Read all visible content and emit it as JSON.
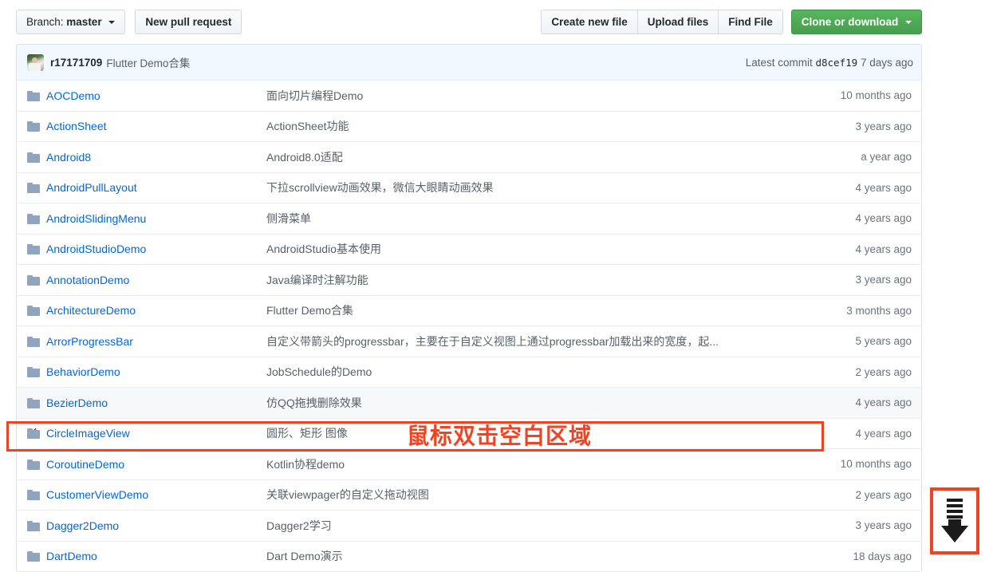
{
  "toolbar": {
    "branch_prefix": "Branch:",
    "branch_name": "master",
    "new_pull_request": "New pull request",
    "create_new_file": "Create new file",
    "upload_files": "Upload files",
    "find_file": "Find File",
    "clone_or_download": "Clone or download"
  },
  "commit_bar": {
    "author": "r17171709",
    "message": "Flutter Demo合集",
    "latest_commit_label": "Latest commit",
    "sha": "d8cef19",
    "age": "7 days ago"
  },
  "annotation": {
    "text": "鼠标双击空白区域",
    "color": "#ef4423"
  },
  "scroll_indicator": {
    "icon": "scroll-down-arrow-icon"
  },
  "colors": {
    "link": "#0366d6",
    "accent_green": "#55b75c",
    "commit_bar_bg": "#f1f8ff",
    "row_hover_bg": "#f6f8fa",
    "border": "#dfe2e5",
    "annotation_red": "#ef4423"
  },
  "files": [
    {
      "name": "AOCDemo",
      "desc": "面向切片编程Demo",
      "age": "10 months ago",
      "state": "normal"
    },
    {
      "name": "ActionSheet",
      "desc": "ActionSheet功能",
      "age": "3 years ago",
      "state": "normal"
    },
    {
      "name": "Android8",
      "desc": "Android8.0适配",
      "age": "a year ago",
      "state": "normal"
    },
    {
      "name": "AndroidPullLayout",
      "desc": "下拉scrollview动画效果，微信大眼睛动画效果",
      "age": "4 years ago",
      "state": "normal"
    },
    {
      "name": "AndroidSlidingMenu",
      "desc": "侧滑菜单",
      "age": "4 years ago",
      "state": "normal"
    },
    {
      "name": "AndroidStudioDemo",
      "desc": "AndroidStudio基本使用",
      "age": "4 years ago",
      "state": "normal"
    },
    {
      "name": "AnnotationDemo",
      "desc": "Java编译时注解功能",
      "age": "3 years ago",
      "state": "normal"
    },
    {
      "name": "ArchitectureDemo",
      "desc": "Flutter Demo合集",
      "age": "3 months ago",
      "state": "normal"
    },
    {
      "name": "ArrorProgressBar",
      "desc": "自定义带箭头的progressbar，主要在于自定义视图上通过progressbar加载出来的宽度，起...",
      "age": "5 years ago",
      "state": "normal"
    },
    {
      "name": "BehaviorDemo",
      "desc": "JobSchedule的Demo",
      "age": "2 years ago",
      "state": "normal"
    },
    {
      "name": "BezierDemo",
      "desc": "仿QQ拖拽删除效果",
      "age": "4 years ago",
      "state": "hovered"
    },
    {
      "name": "CircleImageView",
      "desc": "圆形、矩形 图像",
      "age": "4 years ago",
      "state": "selected"
    },
    {
      "name": "CoroutineDemo",
      "desc": "Kotlin协程demo",
      "age": "10 months ago",
      "state": "normal"
    },
    {
      "name": "CustomerViewDemo",
      "desc": "关联viewpager的自定义拖动视图",
      "age": "2 years ago",
      "state": "normal"
    },
    {
      "name": "Dagger2Demo",
      "desc": "Dagger2学习",
      "age": "3 years ago",
      "state": "normal"
    },
    {
      "name": "DartDemo",
      "desc": "Dart Demo演示",
      "age": "18 days ago",
      "state": "normal"
    }
  ]
}
